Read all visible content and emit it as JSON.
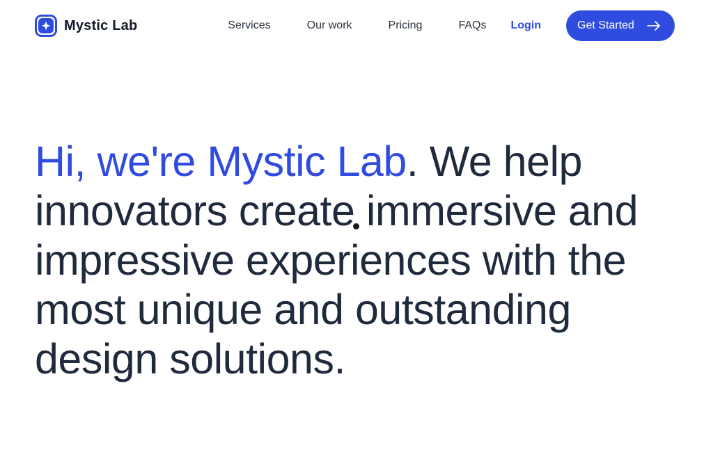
{
  "brand": {
    "name": "Mystic Lab",
    "logo_icon": "sparkle-icon",
    "color": "#2f4be0"
  },
  "nav": {
    "links": [
      {
        "label": "Services"
      },
      {
        "label": "Our work"
      },
      {
        "label": "Pricing"
      },
      {
        "label": "FAQs"
      }
    ],
    "login_label": "Login",
    "cta_label": "Get Started",
    "cta_icon": "arrow-right-icon"
  },
  "hero": {
    "highlight": "Hi, we're Mystic Lab",
    "rest": ". We help innovators create immersive and impressive experiences with the most unique and outstanding design solutions."
  },
  "colors": {
    "accent": "#2f4be0",
    "text": "#1f2a3c",
    "background": "#ffffff"
  }
}
